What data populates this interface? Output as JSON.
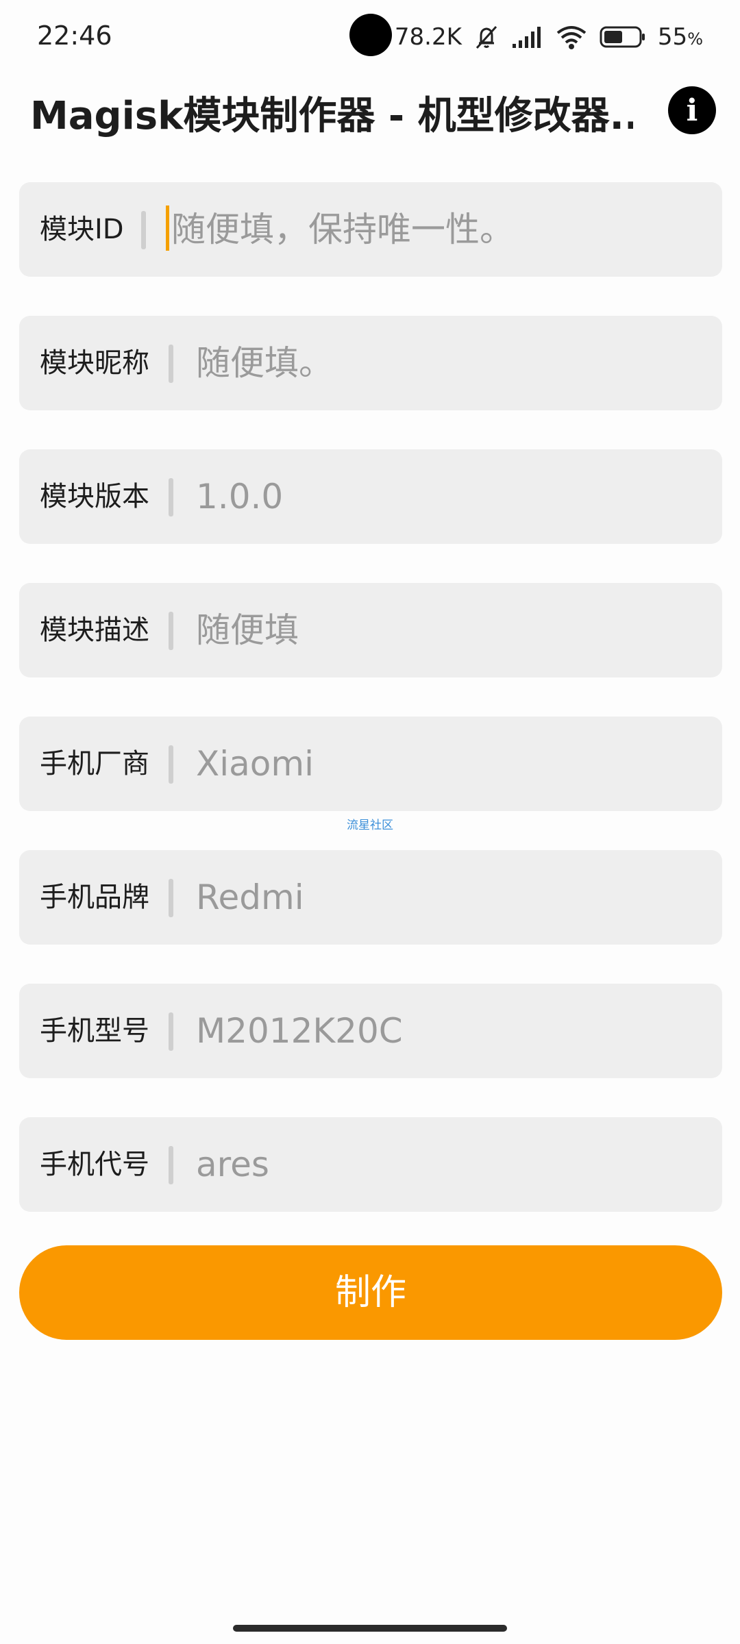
{
  "status_bar": {
    "time": "22:46",
    "net_speed": "78.2K",
    "battery_percent": "55",
    "battery_unit": "%",
    "battery_level": 0.55,
    "icons": [
      "mute-bell-icon",
      "signal-icon",
      "wifi-icon",
      "battery-icon"
    ]
  },
  "app_bar": {
    "title": "Magisk模块制作器 - 机型修改器...",
    "info_icon": "i"
  },
  "fields": [
    {
      "label": "模块ID",
      "placeholder": "随便填，保持唯一性。",
      "focused": true
    },
    {
      "label": "模块昵称",
      "placeholder": "随便填。"
    },
    {
      "label": "模块版本",
      "placeholder": "1.0.0"
    },
    {
      "label": "模块描述",
      "placeholder": "随便填"
    },
    {
      "label": "手机厂商",
      "placeholder": "Xiaomi"
    },
    {
      "label": "手机品牌",
      "placeholder": "Redmi"
    },
    {
      "label": "手机型号",
      "placeholder": "M2012K20C"
    },
    {
      "label": "手机代号",
      "placeholder": "ares"
    }
  ],
  "watermark": "流星社区",
  "make_button": {
    "label": "制作"
  },
  "colors": {
    "accent": "#fa9800",
    "field_bg": "#eeeeee",
    "placeholder": "#9a9a9a"
  }
}
